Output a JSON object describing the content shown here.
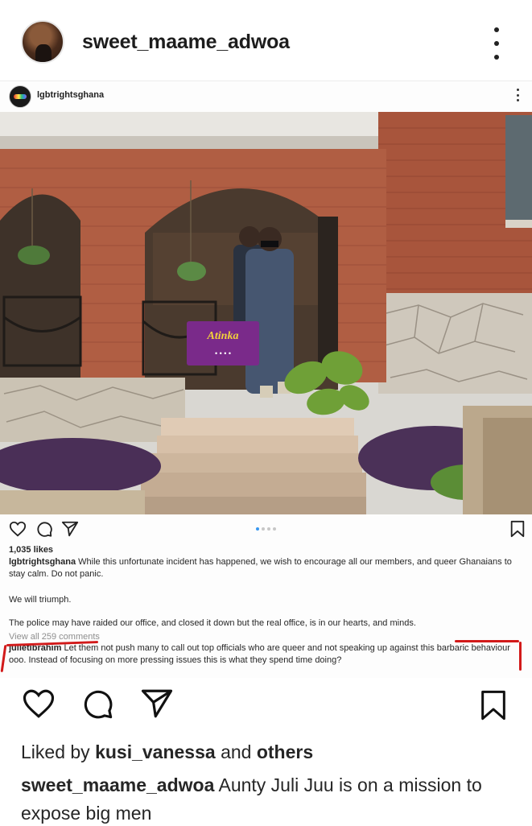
{
  "outer": {
    "username": "sweet_maame_adwoa",
    "liked_prefix": "Liked by ",
    "liked_user": "kusi_vanessa",
    "liked_mid": " and ",
    "liked_suffix": "others",
    "caption_user": "sweet_maame_adwoa",
    "caption_text": " Aunty Juli Juu is on a mission to expose big men"
  },
  "inner": {
    "username": "lgbtrightsghana",
    "likes": "1,035 likes",
    "caption_user": "lgbtrightsghana",
    "caption_text": " While this unfortunate incident has happened, we wish to encourage all our members, and queer Ghanaians to stay calm. Do not panic.",
    "para2": "We will triumph.",
    "para3": "The police may have raided our office, and closed it down but the real office, is in our hearts, and minds.",
    "view_all": "View all 259 comments",
    "comment_user": "julietibrahim",
    "comment_text": " Let them not push many to call out top officials who are queer and not speaking up against this barbaric behaviour ooo.  Instead of focusing on more pressing issues this is what they spend time doing?",
    "carousel": {
      "count": 4,
      "active": 1
    }
  },
  "sign": {
    "line1": "Atinka",
    "line2": "• • • •"
  },
  "colors": {
    "annotation_red": "#d21a1a",
    "carousel_active": "#3897f0"
  },
  "icons": [
    "heart-icon",
    "comment-icon",
    "share-icon",
    "bookmark-icon",
    "more-options-icon"
  ]
}
